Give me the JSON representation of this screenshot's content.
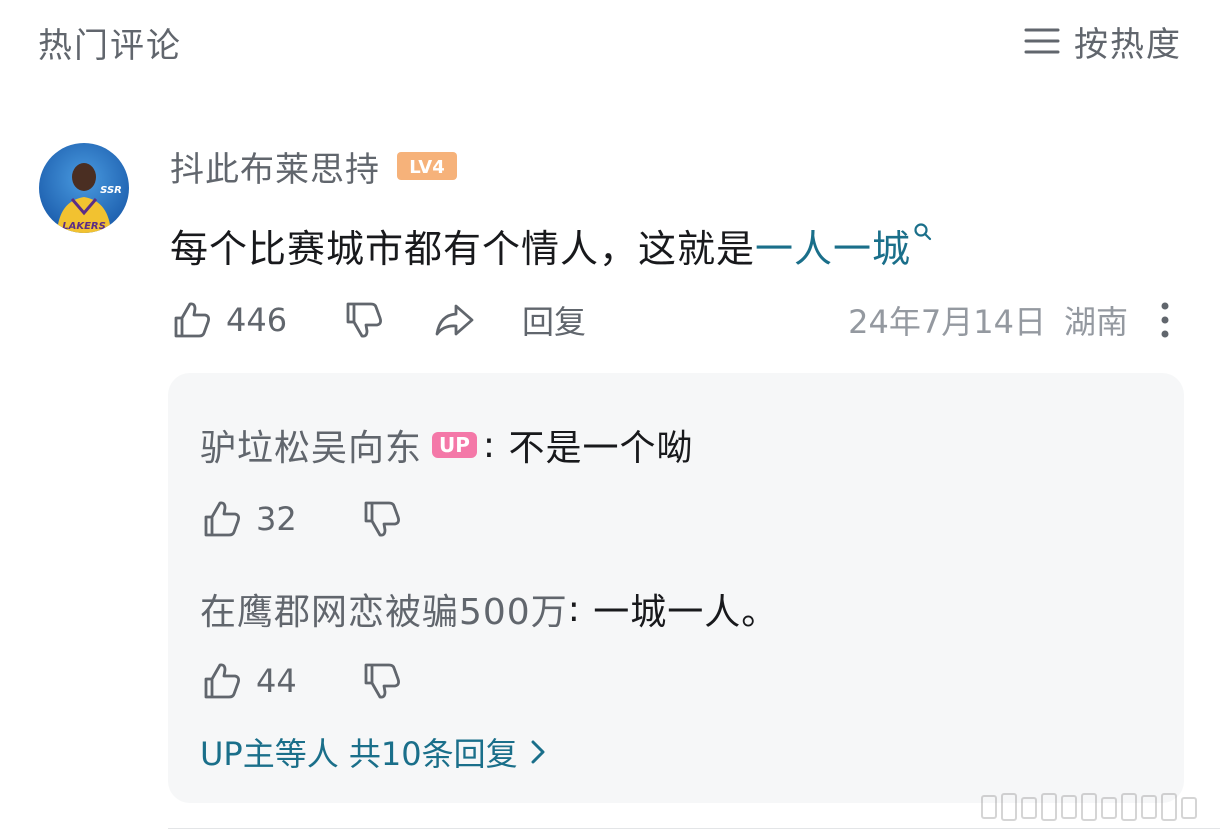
{
  "header": {
    "title": "热门评论",
    "sort_label": "按热度"
  },
  "comment": {
    "username": "抖此布莱思持",
    "level_badge": "LV4",
    "text_prefix": "每个比赛城市都有个情人，这就是",
    "text_keyword": "一人一城",
    "like_count": "446",
    "reply_label": "回复",
    "date": "24年7月14日",
    "location": "湖南",
    "avatar": {
      "caption": "LAKERS",
      "tag": "SSR"
    }
  },
  "replies": [
    {
      "username": "驴垃松吴向东",
      "badge": "UP",
      "text": "不是一个呦",
      "like_count": "32"
    },
    {
      "username": "在鹰郡网恋被骗500万",
      "badge": "",
      "text": "一城一人。",
      "like_count": "44"
    }
  ],
  "more_replies": {
    "label": "UP主等人 共10条回复"
  },
  "colors": {
    "keyword": "#1a6f8a",
    "level_badge": "#f6b27a",
    "up_badge": "#f478a8",
    "reply_bg": "#f6f7f8"
  },
  "icons": [
    "sort-lines-icon",
    "thumbs-up-icon",
    "thumbs-down-icon",
    "share-arrow-icon",
    "more-vertical-icon",
    "search-small-icon",
    "chevron-right-icon"
  ]
}
